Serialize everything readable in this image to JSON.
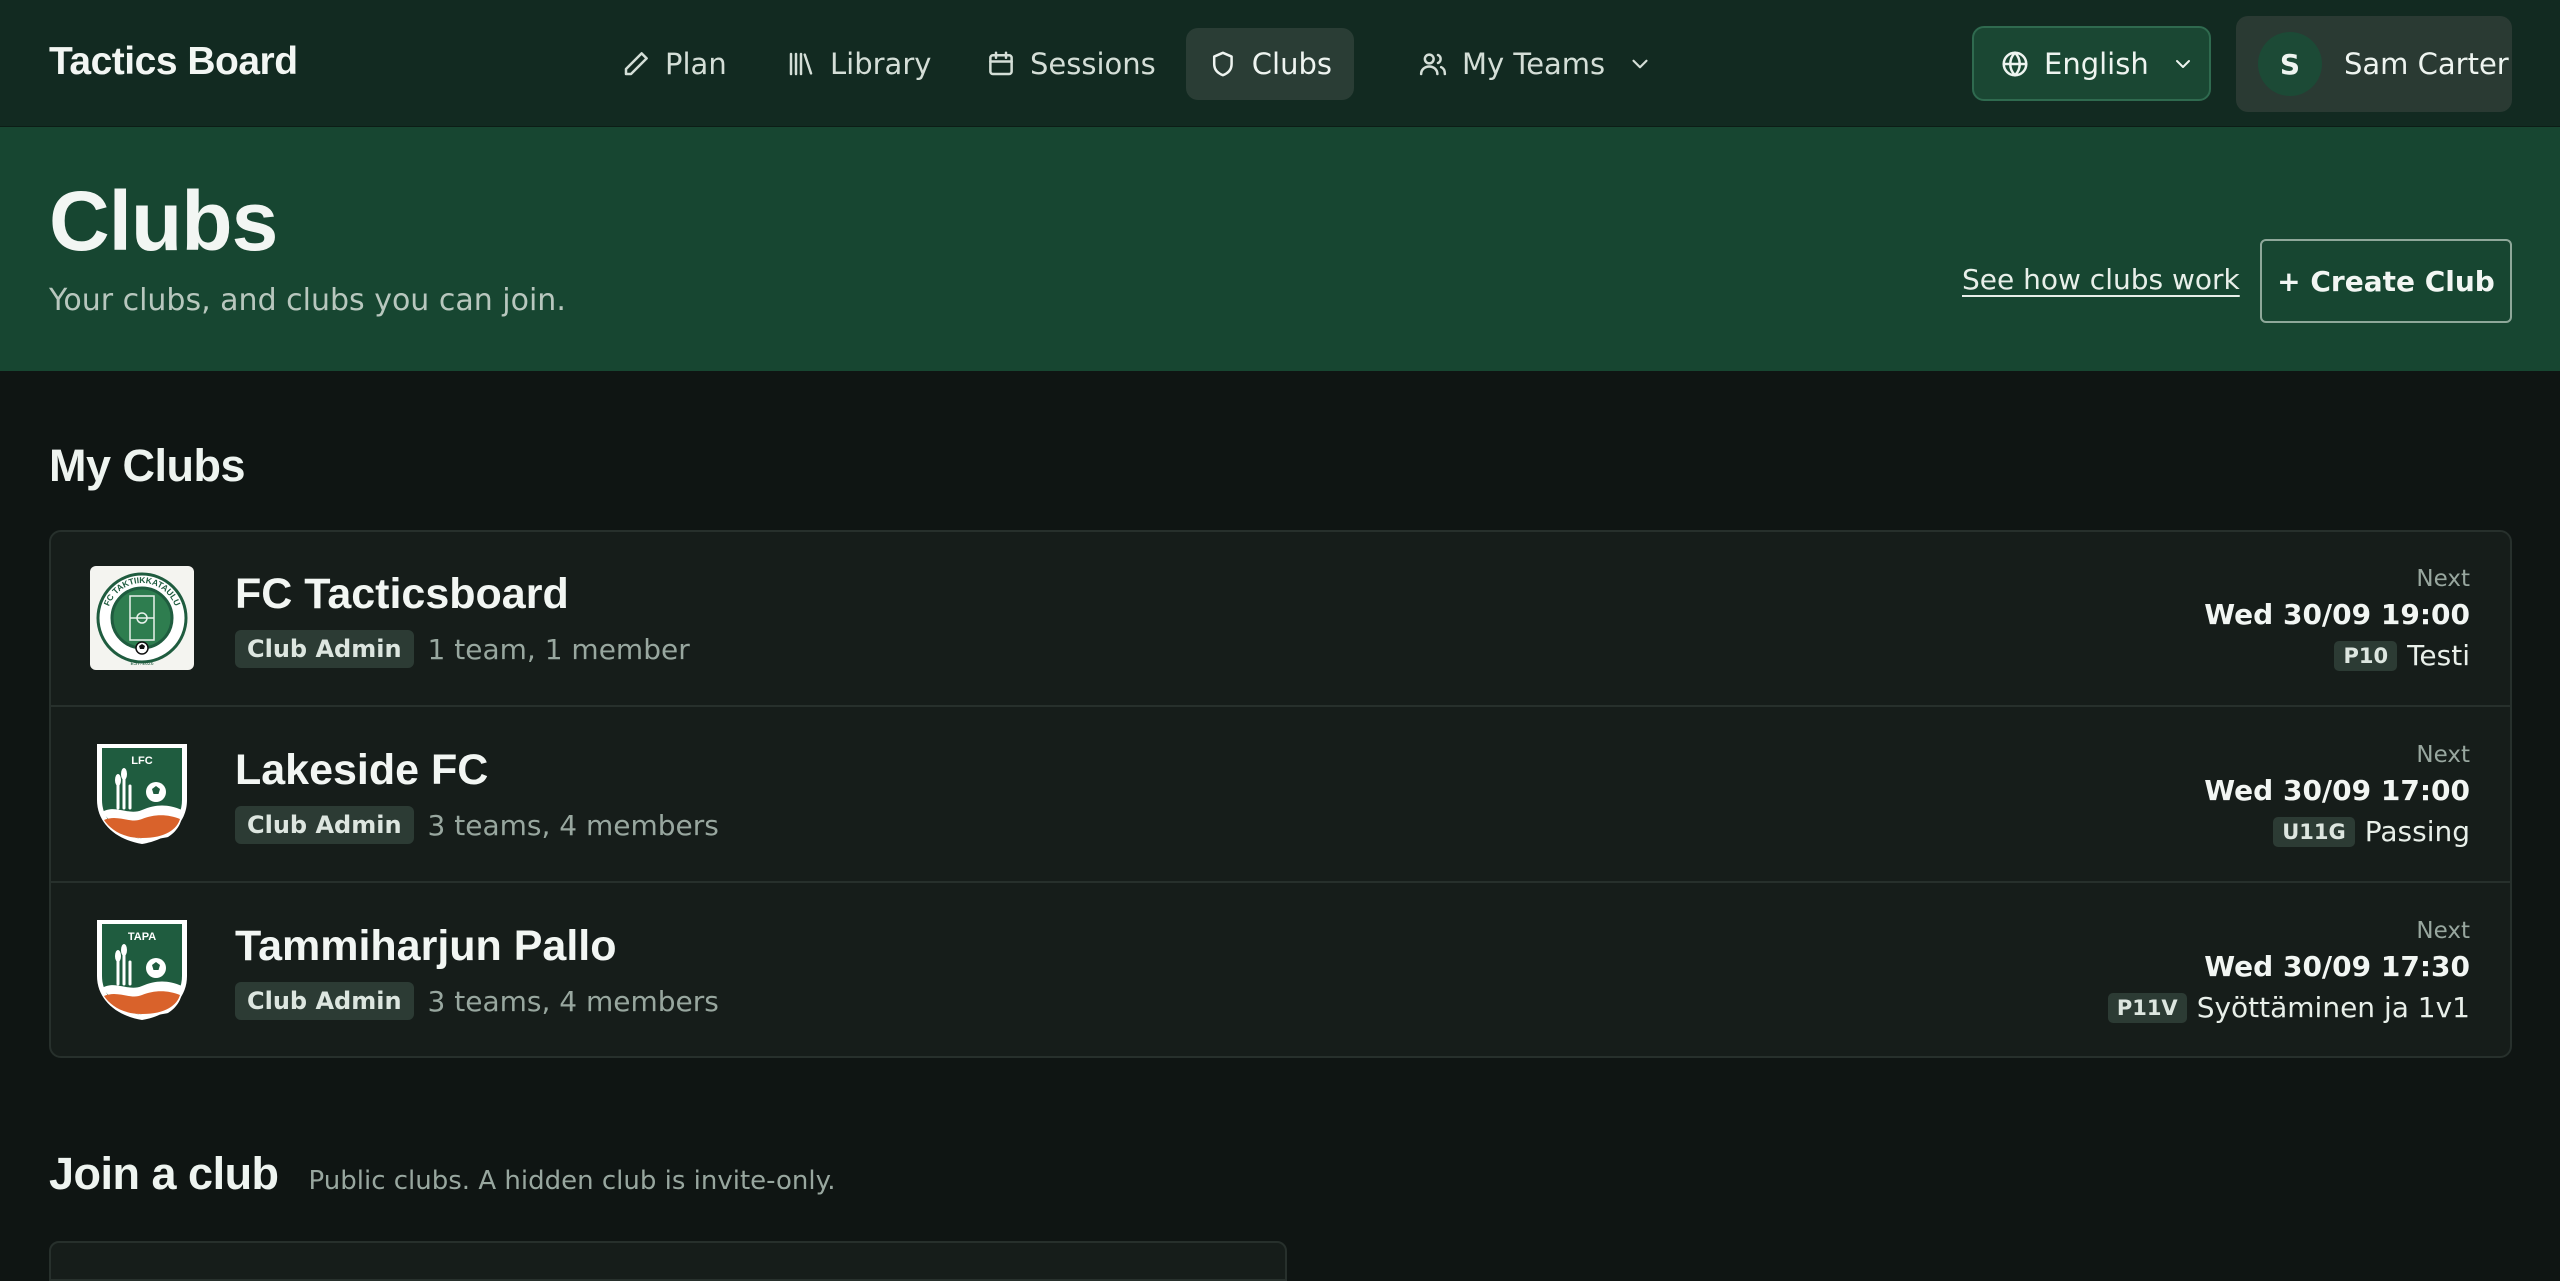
{
  "brand": "Tactics Board",
  "nav": {
    "plan": "Plan",
    "library": "Library",
    "sessions": "Sessions",
    "clubs": "Clubs",
    "my_teams": "My Teams"
  },
  "language": "English",
  "user": {
    "initial": "S",
    "name": "Sam Carter"
  },
  "hero": {
    "title": "Clubs",
    "subtitle": "Your clubs, and clubs you can join.",
    "how_link": "See how clubs work",
    "create_button": "+ Create Club"
  },
  "my_clubs": {
    "title": "My Clubs",
    "clubs": [
      {
        "name": "FC Tacticsboard",
        "role": "Club Admin",
        "summary": "1 team, 1 member",
        "next_label": "Next",
        "next_date": "Wed 30/09 19:00",
        "next_team": "P10",
        "next_event": "Testi",
        "logo_text": "FC TAKTIIKKATAULU",
        "logo_year": "EST. 2026"
      },
      {
        "name": "Lakeside FC",
        "role": "Club Admin",
        "summary": "3 teams, 4 members",
        "next_label": "Next",
        "next_date": "Wed 30/09 17:00",
        "next_team": "U11G",
        "next_event": "Passing",
        "logo_text": "LFC"
      },
      {
        "name": "Tammiharjun Pallo",
        "role": "Club Admin",
        "summary": "3 teams, 4 members",
        "next_label": "Next",
        "next_date": "Wed 30/09 17:30",
        "next_team": "P11V",
        "next_event": "Syöttäminen ja 1v1",
        "logo_text": "TAPA"
      }
    ]
  },
  "join": {
    "title": "Join a club",
    "subtitle": "Public clubs. A hidden club is invite-only."
  },
  "colors": {
    "topbar": "#122a21",
    "hero": "#174631",
    "background": "#0f1513",
    "card": "#161d1a",
    "crest_green": "#1f5c3f",
    "crest_orange": "#d9622b"
  }
}
